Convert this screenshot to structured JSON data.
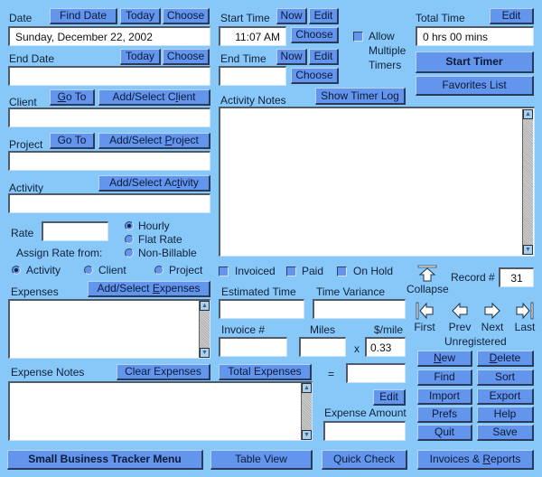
{
  "date": {
    "label": "Date",
    "find_date": "Find Date",
    "today": "Today",
    "choose": "Choose",
    "value": "Sunday, December 22, 2002"
  },
  "end_date": {
    "label": "End Date",
    "today": "Today",
    "choose": "Choose",
    "value": ""
  },
  "start_time": {
    "label": "Start Time",
    "now": "Now",
    "edit": "Edit",
    "choose": "Choose",
    "value": "11:07 AM"
  },
  "end_time": {
    "label": "End Time",
    "now": "Now",
    "edit": "Edit",
    "choose": "Choose",
    "value": ""
  },
  "multiple_timers": {
    "line1": "Allow",
    "line2": "Multiple",
    "line3": "Timers",
    "checked": false
  },
  "total_time": {
    "label": "Total Time",
    "edit": "Edit",
    "value": "0 hrs 00 mins"
  },
  "start_timer": "Start Timer",
  "favorites_list": "Favorites List",
  "client": {
    "label": "Client",
    "goto_pre": "",
    "goto_u": "G",
    "goto_post": "o To",
    "add_pre": "Add/Select C",
    "add_u": "l",
    "add_post": "ient",
    "value": ""
  },
  "project": {
    "label": "Project",
    "goto": "Go To",
    "add_pre": "Add/Select ",
    "add_u": "P",
    "add_post": "roject",
    "value": ""
  },
  "activity": {
    "label": "Activity",
    "add_pre": "Add/Select Ac",
    "add_u": "t",
    "add_post": "ivity",
    "value": ""
  },
  "activity_notes": {
    "label": "Activity Notes",
    "show_timer_log": "Show Timer Log",
    "value": ""
  },
  "rate": {
    "label": "Rate",
    "value": "",
    "options": [
      {
        "label": "Hourly",
        "selected": true
      },
      {
        "label": "Flat Rate",
        "selected": false
      },
      {
        "label": "Non-Billable",
        "selected": false
      }
    ]
  },
  "assign_rate": {
    "label": "Assign Rate from:",
    "options": [
      {
        "label": "Activity",
        "selected": true
      },
      {
        "label": "Client",
        "selected": false
      },
      {
        "label": "Project",
        "selected": false
      }
    ]
  },
  "status_checks": [
    {
      "label": "Invoiced",
      "checked": false
    },
    {
      "label": "Paid",
      "checked": false
    },
    {
      "label": "On Hold",
      "checked": false
    }
  ],
  "expenses": {
    "label": "Expenses",
    "add_pre": "Add/Select ",
    "add_u": "E",
    "add_post": "xpenses"
  },
  "estimated_time": {
    "label": "Estimated Time",
    "value": ""
  },
  "time_variance": {
    "label": "Time Variance",
    "value": ""
  },
  "invoice": {
    "label": "Invoice #",
    "value": ""
  },
  "miles": {
    "label": "Miles",
    "value": "",
    "times": "x"
  },
  "per_mile": {
    "label": "$/mile",
    "value": "0.33"
  },
  "expense_notes": {
    "label": "Expense Notes",
    "clear": "Clear Expenses",
    "total": "Total Expenses",
    "equals": "=",
    "total_value": ""
  },
  "expense_amount": {
    "label": "Expense Amount",
    "edit": "Edit",
    "value": ""
  },
  "record": {
    "collapse": "Collapse",
    "label": "Record #",
    "value": "31",
    "first": "First",
    "prev": "Prev",
    "next": "Next",
    "last": "Last",
    "status": "Unregistered"
  },
  "actions": {
    "new_u": "N",
    "new_post": "ew",
    "delete_u": "D",
    "delete_post": "elete",
    "find": "Find",
    "sort": "Sort",
    "import": "Import",
    "export": "Export",
    "prefs": "Prefs",
    "help": "Help",
    "quit": "Quit",
    "save": "Save"
  },
  "bottom": {
    "menu": "Small Business Tracker Menu",
    "table_view": "Table View",
    "quick_check": "Quick Check",
    "reports_pre": "Invoices & ",
    "reports_u": "R",
    "reports_post": "eports"
  }
}
